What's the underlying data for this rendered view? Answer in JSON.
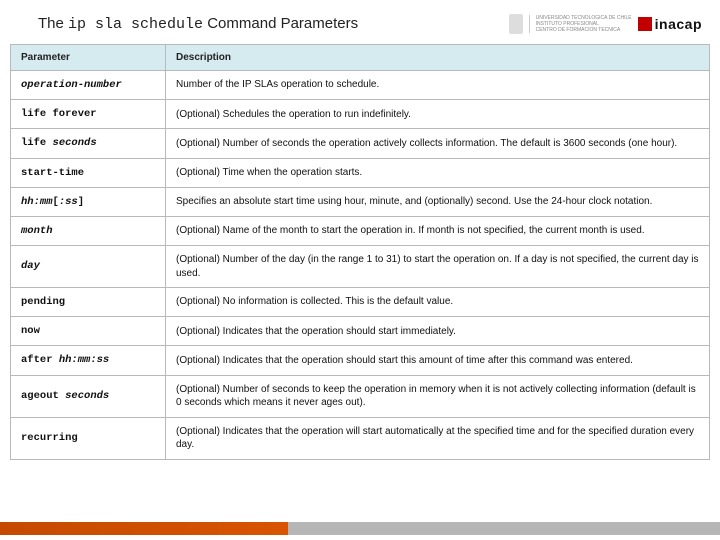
{
  "header": {
    "title_pre": "The ",
    "title_cmd": "ip sla schedule",
    "title_post": " Command Parameters",
    "uni_lines": "UNIVERSIDAD TECNOLOGICA DE CHILE\nINSTITUTO PROFESIONAL\nCENTRO DE FORMACION TECNICA",
    "brand": "inacap"
  },
  "table": {
    "col1": "Parameter",
    "col2": "Description",
    "rows": [
      {
        "p_html": "<span class='ital'>operation-number</span>",
        "d": "Number of the IP SLAs operation to schedule."
      },
      {
        "p_html": "life forever",
        "d": "(Optional) Schedules the operation to run indefinitely."
      },
      {
        "p_html": "life <span class='ital'>seconds</span>",
        "d": "(Optional) Number of seconds the operation actively collects information. The default is 3600 seconds (one hour)."
      },
      {
        "p_html": "start-time",
        "d": "(Optional) Time when the operation starts."
      },
      {
        "p_html": "<span class='ital'>hh:mm</span>[<span class='ital'>:ss</span>]",
        "d": "Specifies an absolute start time using hour, minute, and (optionally) second. Use the 24-hour clock notation."
      },
      {
        "p_html": "<span class='ital'>month</span>",
        "d": "(Optional) Name of the month to start the operation in. If month is not specified, the current month is used."
      },
      {
        "p_html": "<span class='ital'>day</span>",
        "d": "(Optional) Number of the day (in the range 1 to 31) to start the operation on. If a day is not specified, the current day is used."
      },
      {
        "p_html": "pending",
        "d": "(Optional) No information is collected. This is the default value."
      },
      {
        "p_html": "now",
        "d": "(Optional) Indicates that the operation should start immediately."
      },
      {
        "p_html": "after <span class='ital'>hh:mm:ss</span>",
        "d": "(Optional) Indicates that the operation should start this amount of time after this command was entered."
      },
      {
        "p_html": "ageout <span class='ital'>seconds</span>",
        "d": "(Optional) Number of seconds to keep the operation in memory when it is not actively collecting information (default is 0 seconds which means it never ages out)."
      },
      {
        "p_html": "recurring",
        "d": "(Optional) Indicates that the operation will start automatically at the specified time and for the specified duration every day."
      }
    ]
  }
}
